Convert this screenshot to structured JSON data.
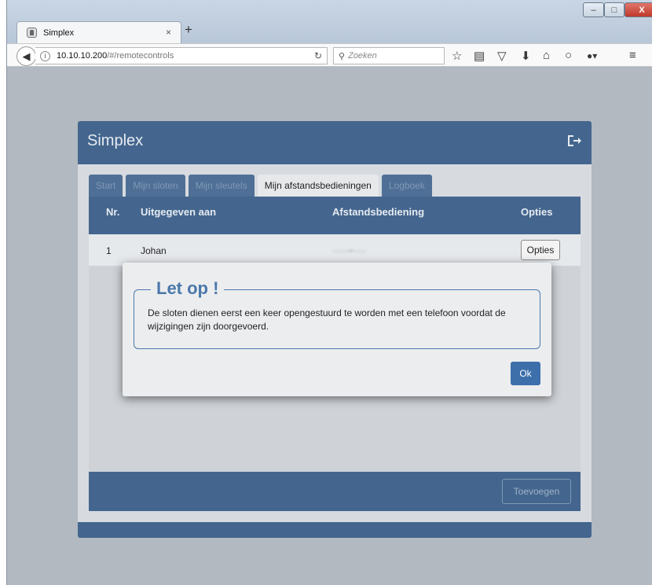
{
  "browser": {
    "tab_title": "Simplex",
    "tab_close": "×",
    "new_tab": "+",
    "url_host": "10.10.10.200",
    "url_path": "/#/remotecontrols",
    "search_placeholder": "Zoeken",
    "window_controls": {
      "minimize": "–",
      "maximize": "□",
      "close": "X"
    }
  },
  "app": {
    "title": "Simplex",
    "tabs": [
      {
        "label": "Start"
      },
      {
        "label": "Mijn sloten"
      },
      {
        "label": "Mijn sleutels"
      },
      {
        "label": "Mijn afstandsbedieningen"
      },
      {
        "label": "Logboek"
      }
    ],
    "table": {
      "headers": {
        "nr": "Nr.",
        "issued_to": "Uitgegeven aan",
        "remote": "Afstandsbediening",
        "options": "Opties"
      },
      "rows": [
        {
          "nr": "1",
          "issued_to": "Johan",
          "remote": "·····−····",
          "options_button": "Opties"
        }
      ]
    },
    "add_button": "Toevoegen"
  },
  "modal": {
    "title": "Let op !",
    "message": "De sloten dienen eerst een keer opengestuurd te worden met een telefoon voordat de wijzigingen zijn doorgevoerd.",
    "ok_button": "Ok"
  }
}
